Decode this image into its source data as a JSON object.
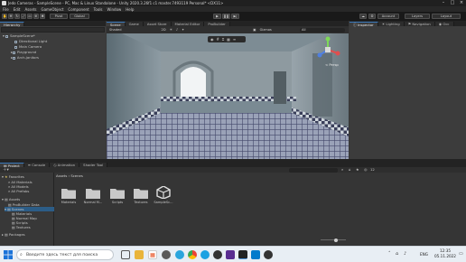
{
  "window": {
    "title": "Jedo Cameras - SampleScene - PC, Mac & Linux Standalone - Unity 2020.3.26f1 c1 master.7493119 Personal* <DX11>"
  },
  "menu": [
    "File",
    "Edit",
    "Assets",
    "GameObject",
    "Component",
    "Tools",
    "Window",
    "Help"
  ],
  "toolbar": {
    "pivot": "Pivot",
    "global": "Global",
    "account": "Account",
    "layers": "Layers",
    "layout": "Layout"
  },
  "hierarchy": {
    "tab": "Hierarchy",
    "scene": "SampleScene*",
    "items": [
      "Directional Light",
      "Main Camera",
      "Playground",
      "Arch-janitors"
    ]
  },
  "center_tabs": [
    "Scene",
    "Game",
    "Asset Store",
    "Material Editor",
    "ProBuilder"
  ],
  "scene_toolbar": {
    "shading": "Shaded",
    "mode": "2D",
    "gizmos": "Gizmos",
    "search_placeholder": "All",
    "persp": "< Persp"
  },
  "right_tabs": [
    "Inspector",
    "Lighting",
    "Navigation",
    "Occ"
  ],
  "project": {
    "tabs": [
      "Project",
      "Console",
      "Animation",
      "Shader Tool"
    ],
    "favorites": {
      "label": "Favorites",
      "items": [
        "All Materials",
        "All Models",
        "All Prefabs"
      ]
    },
    "assets": {
      "label": "Assets",
      "items": [
        "ProBuilder Data",
        "Scenes",
        "Materials",
        "Normal Map",
        "Scripts",
        "Textures"
      ]
    },
    "packages_label": "Packages",
    "breadcrumb": [
      "Assets",
      "Scenes"
    ],
    "files": [
      "Materials",
      "Normal M...",
      "Scripts",
      "Textures",
      "SampleSc..."
    ],
    "count": "12"
  },
  "taskbar": {
    "search_placeholder": "Введите здесь текст для поиска",
    "lang": "ENG",
    "time": "12:35",
    "date": "05.11.2022"
  },
  "colors": {
    "accent": "#3a79bb",
    "folder": "#c9c9c9",
    "editor_bg": "#383838",
    "taskbar_bg": "#e8eef4"
  }
}
